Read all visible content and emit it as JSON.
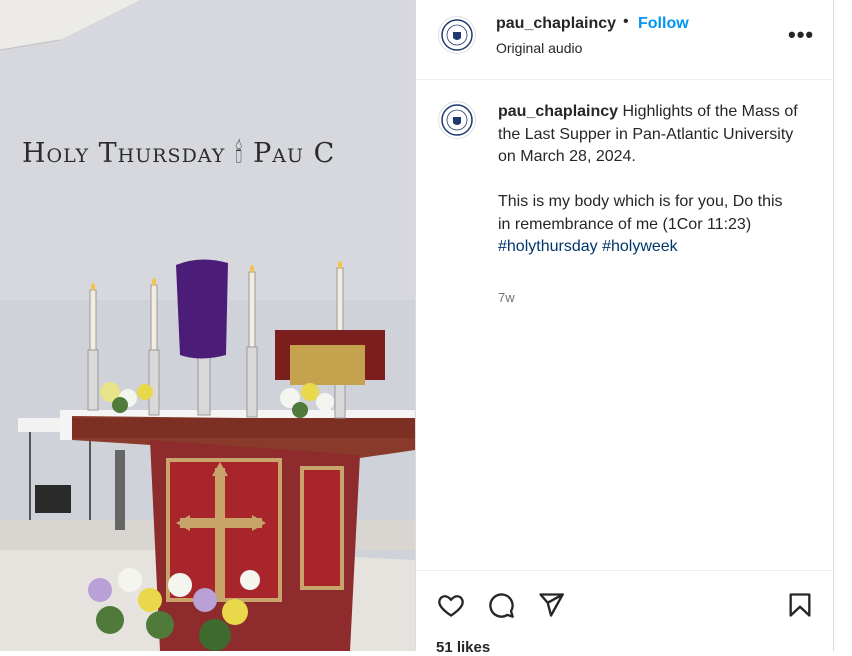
{
  "post": {
    "username": "pau_chaplaincy",
    "separator": "•",
    "follow_label": "Follow",
    "audio_label": "Original audio",
    "more_label": "•••"
  },
  "media": {
    "overlay_text": "Holy Thursday 🕯 Pau C"
  },
  "caption": {
    "username": "pau_chaplaincy",
    "line1": "Highlights of the Mass of the Last Supper in Pan-Atlantic University on March 28, 2024.",
    "line2": "This is my body which is for you, Do this in remembrance of me (1Cor 11:23)",
    "hashtags": "#holythursday #holyweek",
    "time": "7w"
  },
  "actions": {
    "likes": "51 likes"
  },
  "icons": {
    "like": "heart-icon",
    "comment": "comment-bubble-icon",
    "share": "paper-plane-icon",
    "save": "bookmark-icon",
    "more": "more-options-icon"
  }
}
